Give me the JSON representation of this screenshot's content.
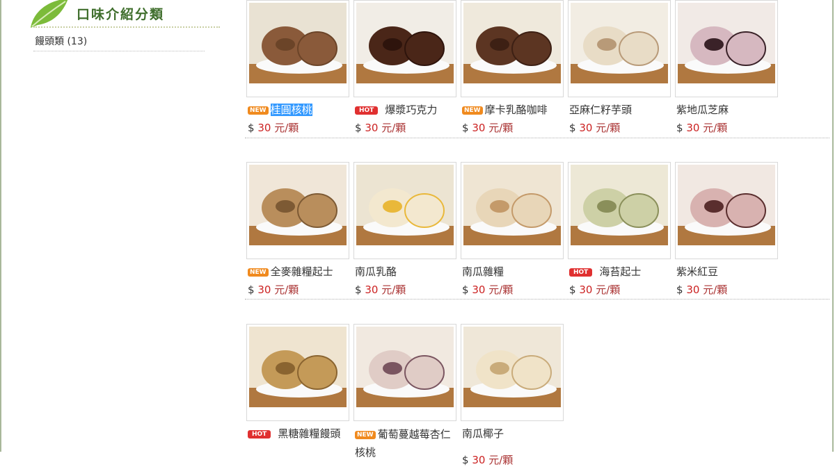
{
  "sidebar": {
    "title": "口味介紹分類",
    "categories": [
      {
        "label": "饅頭類 (13)"
      }
    ]
  },
  "colors": {
    "title_green": "#3f6e2c",
    "price_red": "#cc2222",
    "badge_new": "#f08a1e",
    "badge_hot": "#e03030",
    "selection": "#3399ff"
  },
  "products": [
    {
      "name": "桂圓核桃",
      "badge": "NEW",
      "price_symbol": "$",
      "price": "30",
      "unit": "元/顆",
      "selected": true,
      "image": "two round brown walnut buns on a plate"
    },
    {
      "name": "爆漿巧克力",
      "badge": "HOT",
      "price_symbol": "$",
      "price": "30",
      "unit": "元/顆",
      "image": "chocolate bun held in hand"
    },
    {
      "name": "摩卡乳酪咖啡",
      "badge": "NEW",
      "price_symbol": "$",
      "price": "30",
      "unit": "元/顆",
      "image": "two dark mocha buns with coffee cup"
    },
    {
      "name": "亞麻仁籽芋頭",
      "badge": "",
      "price_symbol": "$",
      "price": "30",
      "unit": "元/顆",
      "image": "swirled flaxseed taro rolls"
    },
    {
      "name": "紫地瓜芝麻",
      "badge": "",
      "price_symbol": "$",
      "price": "30",
      "unit": "元/顆",
      "image": "purple sweet potato sesame swirl rolls"
    },
    {
      "name": "全麥雜糧起士",
      "badge": "NEW",
      "price_symbol": "$",
      "price": "30",
      "unit": "元/顆",
      "image": "whole wheat cheese bun cut open"
    },
    {
      "name": "南瓜乳酪",
      "badge": "",
      "price_symbol": "$",
      "price": "30",
      "unit": "元/顆",
      "image": "pumpkin cheese bun held in hand"
    },
    {
      "name": "南瓜雜糧",
      "badge": "",
      "price_symbol": "$",
      "price": "30",
      "unit": "元/顆",
      "image": "pumpkin multigrain buns on plate"
    },
    {
      "name": "海苔起士",
      "badge": "HOT",
      "price_symbol": "$",
      "price": "30",
      "unit": "元/顆",
      "image": "seaweed cheese bun held in hand"
    },
    {
      "name": "紫米紅豆",
      "badge": "",
      "price_symbol": "$",
      "price": "30",
      "unit": "元/顆",
      "image": "purple rice red bean rolls"
    },
    {
      "name": "黑糖雜糧饅頭",
      "badge": "HOT",
      "price_symbol": "",
      "price": "",
      "unit": "",
      "image": "brown sugar multigrain buns"
    },
    {
      "name": "葡萄蔓越莓杏仁核桃",
      "badge": "NEW",
      "price_symbol": "",
      "price": "",
      "unit": "",
      "image": "raisin cranberry almond buns"
    },
    {
      "name": "南瓜椰子",
      "badge": "",
      "price_symbol": "$",
      "price": "30",
      "unit": "元/顆",
      "image": "pumpkin coconut swirl rolls"
    }
  ]
}
